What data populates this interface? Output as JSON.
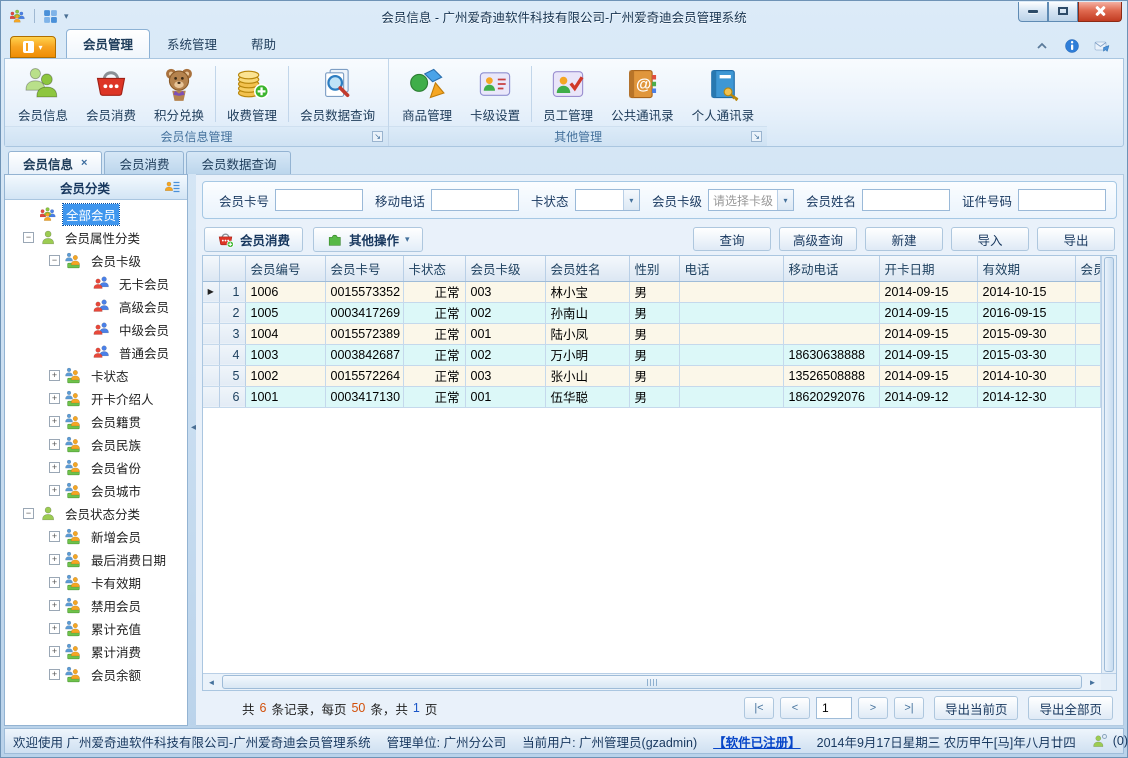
{
  "window": {
    "title": "会员信息 - 广州爱奇迪软件科技有限公司-广州爱奇迪会员管理系统"
  },
  "quick_access_icons": [
    "app-logo-icon",
    "layout-icon",
    "dropdown-arrow-icon"
  ],
  "window_control_icons": [
    "minimize-icon",
    "restore-icon",
    "close-icon"
  ],
  "ribbon": {
    "active_index": 0,
    "tabs": [
      "会员管理",
      "系统管理",
      "帮助"
    ],
    "right_icons": [
      "collapse-ribbon-icon",
      "about-icon",
      "feedback-icon"
    ],
    "groups": [
      {
        "label": "会员信息管理",
        "buttons": [
          {
            "label": "会员信息",
            "icon": "members-icon"
          },
          {
            "label": "会员消费",
            "icon": "basket-icon"
          },
          {
            "label": "积分兑换",
            "icon": "teddy-icon"
          },
          {
            "label": "收费管理",
            "icon": "coins-icon",
            "sep_before": true
          },
          {
            "label": "会员数据查询",
            "icon": "doc-search-icon",
            "sep_before": true
          }
        ]
      },
      {
        "label": "其他管理",
        "buttons": [
          {
            "label": "商品管理",
            "icon": "goods-icon"
          },
          {
            "label": "卡级设置",
            "icon": "card-level-icon"
          },
          {
            "label": "员工管理",
            "icon": "staff-icon",
            "sep_before": true
          },
          {
            "label": "公共通讯录",
            "icon": "public-contacts-icon"
          },
          {
            "label": "个人通讯录",
            "icon": "personal-contacts-icon"
          }
        ]
      }
    ]
  },
  "doc_tabs": [
    {
      "label": "会员信息",
      "active": true,
      "closable": true
    },
    {
      "label": "会员消费"
    },
    {
      "label": "会员数据查询"
    }
  ],
  "sidebar": {
    "title": "会员分类",
    "header_icon": "category-icon",
    "tree": [
      {
        "label": "全部会员",
        "level": 0,
        "icon": "group-icon",
        "selected": true,
        "expander": null
      },
      {
        "label": "会员属性分类",
        "level": 0,
        "icon": "person-green-icon",
        "expander": "minus"
      },
      {
        "label": "会员卡级",
        "level": 1,
        "icon": "people-orange-icon",
        "expander": "minus"
      },
      {
        "label": "无卡会员",
        "level": 2,
        "icon": "member-pair-icon",
        "expander": null
      },
      {
        "label": "高级会员",
        "level": 2,
        "icon": "member-pair-icon",
        "expander": null
      },
      {
        "label": "中级会员",
        "level": 2,
        "icon": "member-pair-icon",
        "expander": null
      },
      {
        "label": "普通会员",
        "level": 2,
        "icon": "member-pair-icon",
        "expander": null
      },
      {
        "label": "卡状态",
        "level": 1,
        "icon": "people-orange-icon",
        "expander": "plus"
      },
      {
        "label": "开卡介绍人",
        "level": 1,
        "icon": "people-orange-icon",
        "expander": "plus"
      },
      {
        "label": "会员籍贯",
        "level": 1,
        "icon": "people-orange-icon",
        "expander": "plus"
      },
      {
        "label": "会员民族",
        "level": 1,
        "icon": "people-orange-icon",
        "expander": "plus"
      },
      {
        "label": "会员省份",
        "level": 1,
        "icon": "people-orange-icon",
        "expander": "plus"
      },
      {
        "label": "会员城市",
        "level": 1,
        "icon": "people-orange-icon",
        "expander": "plus"
      },
      {
        "label": "会员状态分类",
        "level": 0,
        "icon": "person-green-icon",
        "expander": "minus"
      },
      {
        "label": "新增会员",
        "level": 1,
        "icon": "people-orange-icon",
        "expander": "plus"
      },
      {
        "label": "最后消费日期",
        "level": 1,
        "icon": "people-orange-icon",
        "expander": "plus"
      },
      {
        "label": "卡有效期",
        "level": 1,
        "icon": "people-orange-icon",
        "expander": "plus"
      },
      {
        "label": "禁用会员",
        "level": 1,
        "icon": "people-orange-icon",
        "expander": "plus"
      },
      {
        "label": "累计充值",
        "level": 1,
        "icon": "people-orange-icon",
        "expander": "plus"
      },
      {
        "label": "累计消费",
        "level": 1,
        "icon": "people-orange-icon",
        "expander": "plus"
      },
      {
        "label": "会员余额",
        "level": 1,
        "icon": "people-orange-icon",
        "expander": "plus"
      }
    ]
  },
  "filters": [
    {
      "label": "会员卡号",
      "type": "input",
      "value": ""
    },
    {
      "label": "移动电话",
      "type": "input",
      "value": ""
    },
    {
      "label": "卡状态",
      "type": "select",
      "value": ""
    },
    {
      "label": "会员卡级",
      "type": "select",
      "value": "请选择卡级"
    },
    {
      "label": "会员姓名",
      "type": "input",
      "value": ""
    },
    {
      "label": "证件号码",
      "type": "input",
      "value": ""
    }
  ],
  "toolbar": {
    "primary": [
      {
        "label": "会员消费",
        "icon": "basket-add-icon"
      },
      {
        "label": "其他操作",
        "icon": "puzzle-icon",
        "dropdown": true
      }
    ],
    "actions": [
      "查询",
      "高级查询",
      "新建",
      "导入",
      "导出"
    ]
  },
  "grid": {
    "columns": [
      "会员编号",
      "会员卡号",
      "卡状态",
      "会员卡级",
      "会员姓名",
      "性别",
      "电话",
      "移动电话",
      "开卡日期",
      "有效期",
      "会员"
    ],
    "rows": [
      {
        "num": "1",
        "current": true,
        "cells": [
          "1006",
          "0015573352",
          "正常",
          "003",
          "林小宝",
          "男",
          "",
          "",
          "2014-09-15",
          "2014-10-15",
          ""
        ]
      },
      {
        "num": "2",
        "cells": [
          "1005",
          "0003417269",
          "正常",
          "002",
          "孙南山",
          "男",
          "",
          "",
          "2014-09-15",
          "2016-09-15",
          ""
        ]
      },
      {
        "num": "3",
        "cells": [
          "1004",
          "0015572389",
          "正常",
          "001",
          "陆小凤",
          "男",
          "",
          "",
          "2014-09-15",
          "2015-09-30",
          ""
        ]
      },
      {
        "num": "4",
        "cells": [
          "1003",
          "0003842687",
          "正常",
          "002",
          "万小明",
          "男",
          "",
          "18630638888",
          "2014-09-15",
          "2015-03-30",
          ""
        ]
      },
      {
        "num": "5",
        "cells": [
          "1002",
          "0015572264",
          "正常",
          "003",
          "张小山",
          "男",
          "",
          "13526508888",
          "2014-09-15",
          "2014-10-30",
          ""
        ]
      },
      {
        "num": "6",
        "cells": [
          "1001",
          "0003417130",
          "正常",
          "001",
          "伍华聪",
          "男",
          "",
          "18620292076",
          "2014-09-12",
          "2014-12-30",
          ""
        ]
      }
    ]
  },
  "pager": {
    "seg1": "共",
    "total": "6",
    "seg2": "条记录，每页",
    "size": "50",
    "seg3": "条，共",
    "pages": "1",
    "seg4": "页",
    "first": "|<",
    "prev": "<",
    "page": "1",
    "next": ">",
    "last": ">|",
    "export_current": "导出当前页",
    "export_all": "导出全部页"
  },
  "statusbar": {
    "welcome": "欢迎使用 广州爱奇迪软件科技有限公司-广州爱奇迪会员管理系统",
    "org": "管理单位: 广州分公司",
    "user": "当前用户: 广州管理员(gzadmin)",
    "license": "【软件已注册】",
    "date": "2014年9月17日星期三 农历甲午[马]年八月廿四",
    "online_icon": "online-user-icon",
    "online_count": "(0)"
  },
  "colors": {
    "accent_orange": "#f7a320",
    "row_cream": "#fbf7e9",
    "row_cyan": "#dcf8f8",
    "selection_blue": "#3f96ee",
    "link_blue": "#0645c8",
    "close_red": "#c13c22"
  }
}
